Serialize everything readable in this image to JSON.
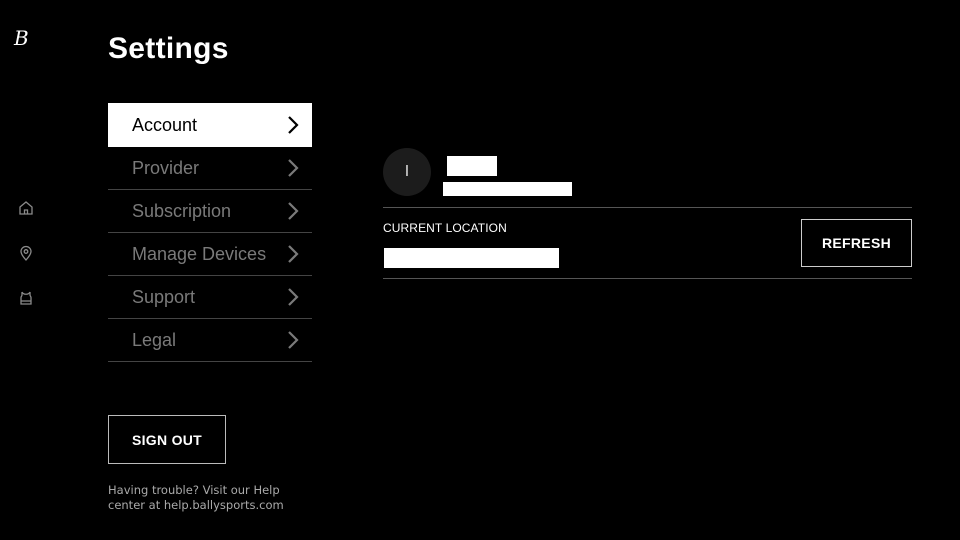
{
  "app": {
    "logo_glyph": "B"
  },
  "rail": {
    "items": [
      {
        "icon": "home-icon"
      },
      {
        "icon": "location-pin-icon"
      },
      {
        "icon": "jersey-icon"
      }
    ]
  },
  "page": {
    "title": "Settings"
  },
  "menu": {
    "items": [
      {
        "label": "Account",
        "active": true
      },
      {
        "label": "Provider",
        "active": false
      },
      {
        "label": "Subscription",
        "active": false
      },
      {
        "label": "Manage Devices",
        "active": false
      },
      {
        "label": "Support",
        "active": false
      },
      {
        "label": "Legal",
        "active": false
      }
    ]
  },
  "signout": {
    "label": "SIGN OUT"
  },
  "help": {
    "text": "Having trouble? Visit our Help center at help.ballysports.com"
  },
  "account": {
    "avatar_initial": "I",
    "current_location_label": "CURRENT LOCATION",
    "refresh_label": "REFRESH"
  }
}
